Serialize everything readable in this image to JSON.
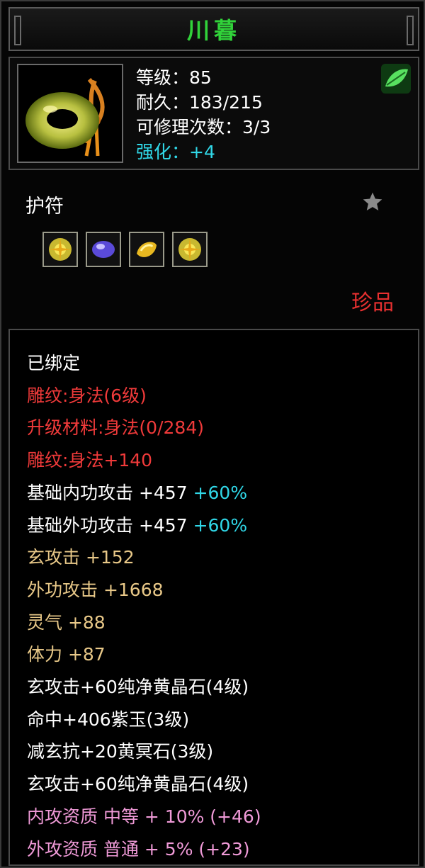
{
  "header": {
    "title": "川暮"
  },
  "item": {
    "level_label": "等级：85",
    "durability_label": "耐久：183/215",
    "repair_label": "可修理次数：3/3",
    "enhance_label": "强化：+4",
    "icon": "jade-ring-icon",
    "class_icon": "green-leaf-icon"
  },
  "type_label": "护符",
  "favorite_icon": "star-icon",
  "gem_slots": [
    "yellow-crystal-gem-icon",
    "purple-jade-gem-icon",
    "gold-stone-gem-icon",
    "yellow-crystal-gem-icon"
  ],
  "rarity_label": "珍品",
  "attributes": [
    {
      "text": "已绑定",
      "color": "white"
    },
    {
      "text": "雕纹:身法(6级)",
      "color": "red"
    },
    {
      "text": "升级材料:身法(0/284)",
      "color": "red"
    },
    {
      "text": "雕纹:身法+140",
      "color": "red"
    },
    {
      "text": "基础内功攻击  +457",
      "extra": " +60%",
      "color": "white"
    },
    {
      "text": "基础外功攻击  +457",
      "extra": " +60%",
      "color": "white"
    },
    {
      "text": "玄攻击  +152",
      "color": "gold"
    },
    {
      "text": "外功攻击  +1668",
      "color": "gold"
    },
    {
      "text": "灵气  +88",
      "color": "gold"
    },
    {
      "text": "体力  +87",
      "color": "gold"
    },
    {
      "text": "玄攻击+60纯净黄晶石(4级)",
      "color": "white"
    },
    {
      "text": "命中+406紫玉(3级)",
      "color": "white"
    },
    {
      "text": "减玄抗+20黄冥石(3级)",
      "color": "white"
    },
    {
      "text": "玄攻击+60纯净黄晶石(4级)",
      "color": "white"
    },
    {
      "text": "内攻资质  中等  + 10% (+46)",
      "color": "pink"
    },
    {
      "text": "外攻资质  普通  + 5% (+23)",
      "color": "pink"
    }
  ],
  "colors": {
    "title": "#31d23a",
    "cyan": "#30d8e8",
    "red": "#f03a3a",
    "gold": "#e8c888",
    "pink": "#f09ad8"
  }
}
